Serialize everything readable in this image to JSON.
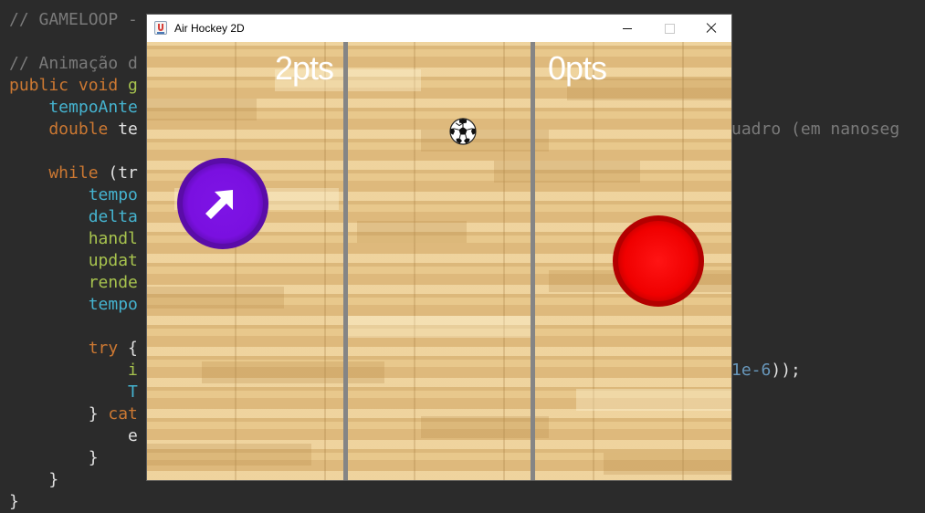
{
  "editor": {
    "lines": [
      {
        "parts": [
          {
            "t": "// GAMELOOP -",
            "c": "comment"
          }
        ]
      },
      {
        "parts": []
      },
      {
        "parts": [
          {
            "t": "// Animação d",
            "c": "comment"
          }
        ]
      },
      {
        "parts": [
          {
            "t": "public void ",
            "c": "kw"
          },
          {
            "t": "g",
            "c": "fn"
          }
        ]
      },
      {
        "parts": [
          {
            "t": "    tempoAnte",
            "c": "id"
          }
        ]
      },
      {
        "parts": [
          {
            "t": "    double ",
            "c": "kw"
          },
          {
            "t": "te",
            "c": "plain"
          }
        ]
      },
      {
        "parts": []
      },
      {
        "parts": [
          {
            "t": "    while ",
            "c": "kw"
          },
          {
            "t": "(tr",
            "c": "plain"
          }
        ]
      },
      {
        "parts": [
          {
            "t": "        tempo",
            "c": "id"
          }
        ]
      },
      {
        "parts": [
          {
            "t": "        delta",
            "c": "id"
          }
        ]
      },
      {
        "parts": [
          {
            "t": "        handl",
            "c": "fn"
          }
        ]
      },
      {
        "parts": [
          {
            "t": "        updat",
            "c": "fn"
          }
        ]
      },
      {
        "parts": [
          {
            "t": "        rende",
            "c": "fn"
          }
        ]
      },
      {
        "parts": [
          {
            "t": "        tempo",
            "c": "id"
          }
        ]
      },
      {
        "parts": []
      },
      {
        "parts": [
          {
            "t": "        try ",
            "c": "kw"
          },
          {
            "t": "{",
            "c": "plain"
          }
        ]
      },
      {
        "parts": [
          {
            "t": "            i",
            "c": "fn"
          }
        ]
      },
      {
        "parts": [
          {
            "t": "            T",
            "c": "id"
          }
        ]
      },
      {
        "parts": [
          {
            "t": "        } ",
            "c": "plain"
          },
          {
            "t": "cat",
            "c": "kw"
          }
        ]
      },
      {
        "parts": [
          {
            "t": "            e",
            "c": "plain"
          }
        ]
      },
      {
        "parts": [
          {
            "t": "        }",
            "c": "plain"
          }
        ]
      },
      {
        "parts": [
          {
            "t": "    }",
            "c": "plain"
          }
        ]
      },
      {
        "parts": [
          {
            "t": "}",
            "c": "plain"
          }
        ]
      }
    ],
    "right_snippets": [
      {
        "line": 5,
        "parts": [
          {
            "t": "uadro (em nanoseg",
            "c": "comment"
          }
        ]
      },
      {
        "line": 16,
        "parts": [
          {
            "t": "1e-6",
            "c": "num"
          },
          {
            "t": "));",
            "c": "plain"
          }
        ]
      }
    ]
  },
  "window": {
    "title": "Air Hockey 2D",
    "buttons": {
      "minimize": "minimize",
      "maximize": "maximize",
      "close": "close"
    }
  },
  "game": {
    "score_left": "2pts",
    "score_right": "0pts",
    "left_paddle_color": "#7a10e0",
    "right_paddle_color": "#f00000",
    "divider_color": "#858585",
    "floor_color": "#e6c488"
  }
}
